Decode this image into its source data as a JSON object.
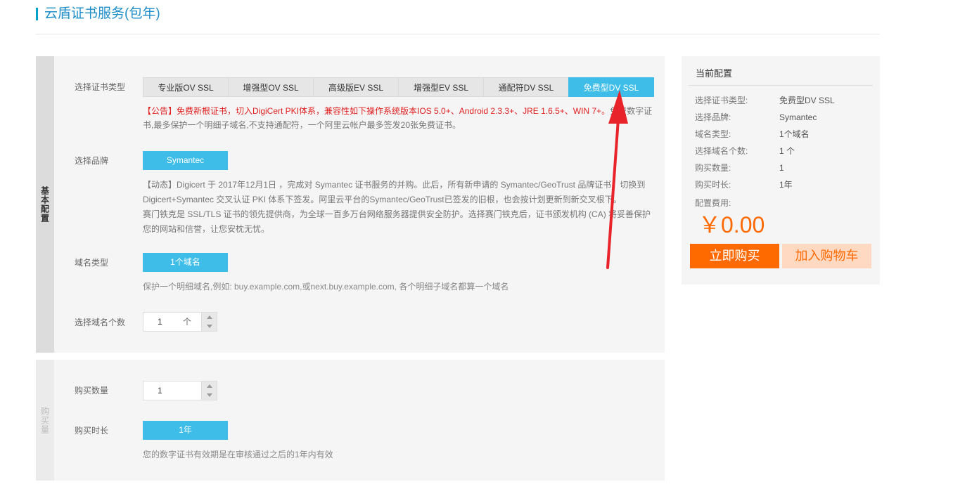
{
  "page": {
    "title": "云盾证书服务(包年)"
  },
  "basic_section": {
    "side_label": "基本配置",
    "cert_type": {
      "label": "选择证书类型",
      "options": [
        "专业版OV SSL",
        "增强型OV SSL",
        "高级版EV SSL",
        "增强型EV SSL",
        "通配符DV SSL",
        "免费型DV SSL"
      ],
      "selected": "免费型DV SSL",
      "notice_red": "【公告】免费新根证书，切入DigiCert PKI体系，兼容性如下操作系统版本IOS 5.0+、Android 2.3.3+、JRE 1.6.5+、WIN 7+。",
      "notice_gray": "免费数字证书,最多保护一个明细子域名,不支持通配符，一个阿里云帐户最多签发20张免费证书。"
    },
    "brand": {
      "label": "选择品牌",
      "button": "Symantec",
      "news": "【动态】Digicert 于 2017年12月1日 ，完成对 Symantec 证书服务的并购。此后，所有新申请的 Symantec/GeoTrust 品牌证书，切换到 Digicert+Symantec 交叉认证 PKI 体系下签发。阿里云平台的Symantec/GeoTrust已签发的旧根，也会按计划更新到新交叉根下。",
      "news2": "赛门铁克是 SSL/TLS 证书的领先提供商，为全球一百多万台网络服务器提供安全防护。选择赛门铁克后，证书颁发机构 (CA) 将妥善保护您的网站和信誉，让您安枕无忧。"
    },
    "domain_type": {
      "label": "域名类型",
      "button": "1个域名",
      "hint": "保护一个明细域名,例如: buy.example.com,或next.buy.example.com, 各个明细子域名都算一个域名"
    },
    "domain_count": {
      "label": "选择域名个数",
      "value": "1",
      "unit": "个"
    }
  },
  "buy_section": {
    "side_label": "购买量",
    "quantity": {
      "label": "购买数量",
      "value": "1"
    },
    "duration": {
      "label": "购买时长",
      "button": "1年",
      "hint": "您的数字证书有效期是在审核通过之后的1年内有效"
    }
  },
  "config": {
    "title": "当前配置",
    "rows": [
      {
        "key": "选择证书类型:",
        "value": "免费型DV SSL"
      },
      {
        "key": "选择品牌:",
        "value": "Symantec"
      },
      {
        "key": "域名类型:",
        "value": "1个域名"
      },
      {
        "key": "选择域名个数:",
        "value": "1 个"
      },
      {
        "key": "购买数量:",
        "value": "1"
      },
      {
        "key": "购买时长:",
        "value": "1年"
      }
    ],
    "fee_label": "配置费用:",
    "price": "￥0.00",
    "buy_button": "立即购买",
    "cart_button": "加入购物车"
  },
  "colors": {
    "accent": "#3dbde8",
    "orange": "#ff6a00",
    "notice_red": "#e02020",
    "arrow": "#e8232a"
  }
}
